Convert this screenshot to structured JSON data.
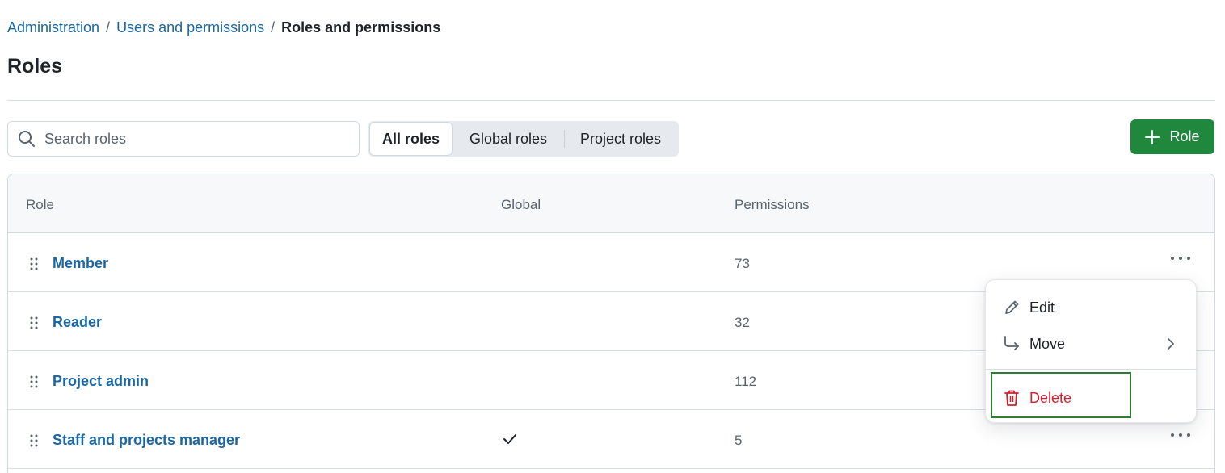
{
  "breadcrumb": {
    "items": [
      "Administration",
      "Users and permissions"
    ],
    "current": "Roles and permissions"
  },
  "page": {
    "title": "Roles"
  },
  "search": {
    "placeholder": "Search roles",
    "value": ""
  },
  "filters": {
    "options": [
      "All roles",
      "Global roles",
      "Project roles"
    ],
    "selected": "All roles"
  },
  "add_button": {
    "label": "Role"
  },
  "table": {
    "columns": [
      "Role",
      "Global",
      "Permissions"
    ],
    "rows": [
      {
        "name": "Member",
        "global": false,
        "permissions": "73"
      },
      {
        "name": "Reader",
        "global": false,
        "permissions": "32"
      },
      {
        "name": "Project admin",
        "global": false,
        "permissions": "112"
      },
      {
        "name": "Staff and projects manager",
        "global": true,
        "permissions": "5"
      }
    ]
  },
  "context_menu": {
    "items": [
      "Edit",
      "Move",
      "Delete"
    ]
  },
  "colors": {
    "link": "#1a67a3",
    "primary_button": "#1f883d",
    "danger": "#cf222e",
    "highlight_box": "#2f7d32"
  }
}
